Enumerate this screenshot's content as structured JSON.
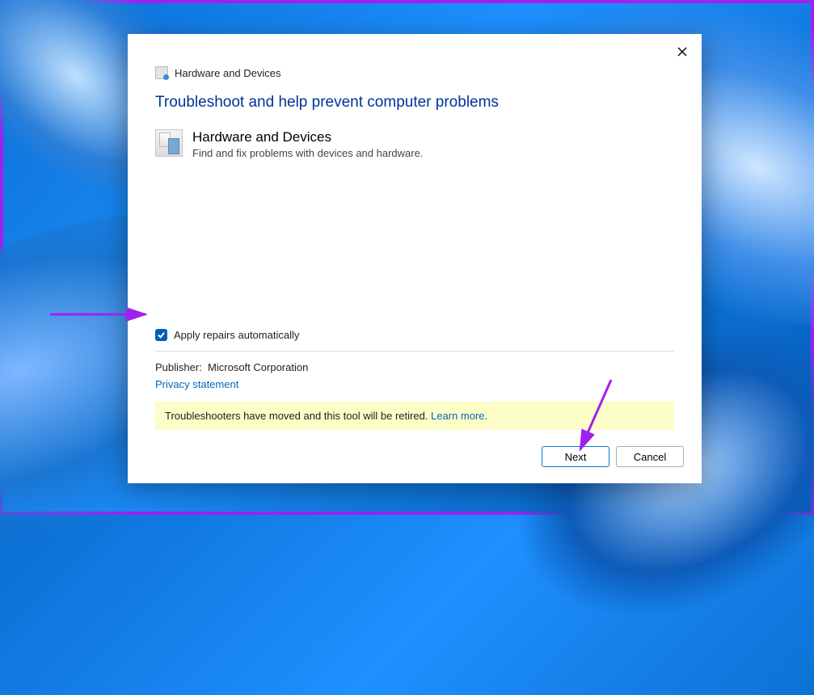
{
  "header": {
    "title": "Hardware and Devices"
  },
  "main": {
    "headline": "Troubleshoot and help prevent computer problems",
    "section_title": "Hardware and Devices",
    "section_sub": "Find and fix problems with devices and hardware."
  },
  "checkbox": {
    "label": "Apply repairs automatically",
    "checked": true
  },
  "publisher": {
    "label": "Publisher:",
    "value": "Microsoft Corporation"
  },
  "links": {
    "privacy": "Privacy statement",
    "learn_more": "Learn more."
  },
  "notice": {
    "text": "Troubleshooters have moved and this tool will be retired."
  },
  "buttons": {
    "next": "Next",
    "cancel": "Cancel"
  }
}
